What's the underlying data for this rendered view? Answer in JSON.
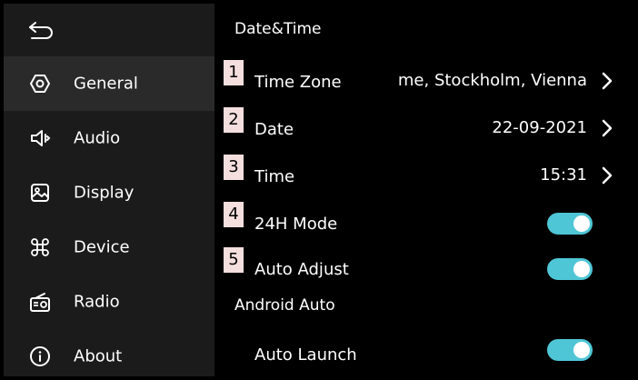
{
  "sidebar": {
    "items": [
      {
        "label": "General",
        "icon": "settings-hexagon-icon"
      },
      {
        "label": "Audio",
        "icon": "speaker-icon"
      },
      {
        "label": "Display",
        "icon": "image-icon"
      },
      {
        "label": "Device",
        "icon": "command-icon"
      },
      {
        "label": "Radio",
        "icon": "radio-icon"
      },
      {
        "label": "About",
        "icon": "info-icon"
      }
    ],
    "active": "General"
  },
  "main": {
    "section_title": "Date&Time",
    "rows": [
      {
        "num": "1",
        "label": "Time Zone",
        "value": "me, Stockholm, Vienna"
      },
      {
        "num": "2",
        "label": "Date",
        "value": "22-09-2021"
      },
      {
        "num": "3",
        "label": "Time",
        "value": "15:31"
      },
      {
        "num": "4",
        "label": "24H Mode",
        "toggle_on": true
      },
      {
        "num": "5",
        "label": "Auto Adjust",
        "toggle_on": true
      }
    ],
    "android_auto": {
      "title": "Android Auto",
      "auto_launch_label": "Auto Launch",
      "auto_launch_on": true
    }
  },
  "colors": {
    "accent": "#4fc6d6",
    "sidebar_bg": "#1b1b1b",
    "active_bg": "#2a2a2a",
    "badge_bg": "#f4dede"
  }
}
